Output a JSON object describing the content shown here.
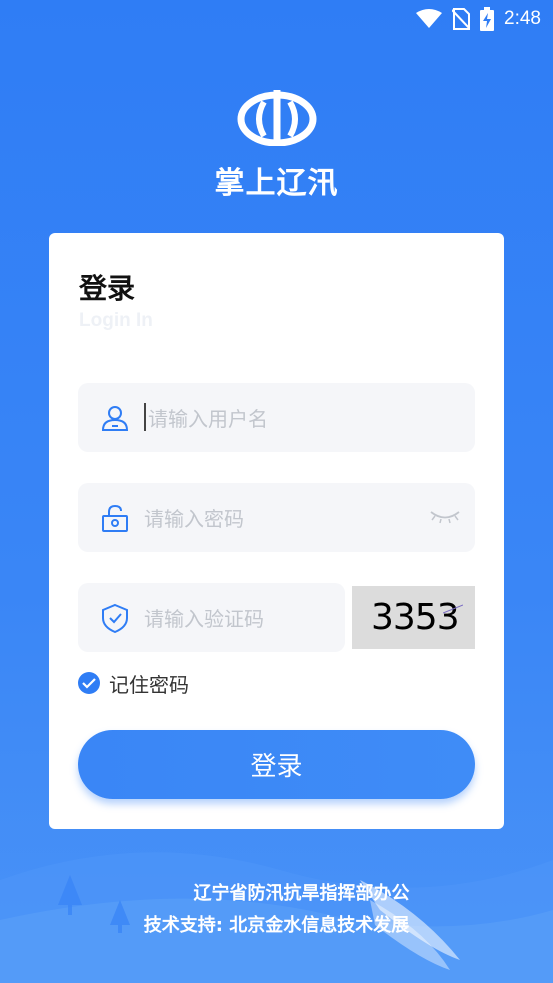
{
  "status_bar": {
    "time": "2:48",
    "icons": [
      "wifi-icon",
      "no-sim-icon",
      "battery-charging-icon"
    ]
  },
  "app": {
    "title": "掌上辽汛",
    "logo_icon": "shuili-logo-icon"
  },
  "login_card": {
    "title": "登录",
    "subtitle": "Login In",
    "username_placeholder": "请输入用户名",
    "password_placeholder": "请输入密码",
    "captcha_placeholder": "请输入验证码",
    "captcha_code": "3353",
    "remember_label": "记住密码",
    "remember_checked": true,
    "login_button": "登录"
  },
  "footer": {
    "line1": "辽宁省防汛抗旱指挥部办公",
    "line2": "技术支持: 北京金水信息技术发展"
  },
  "colors": {
    "primary": "#2f7df5",
    "card": "#ffffff",
    "field_bg": "#f5f6f9",
    "placeholder": "#c2c6cd"
  }
}
